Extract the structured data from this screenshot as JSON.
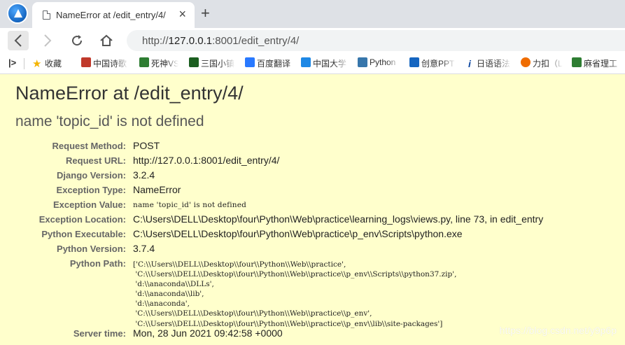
{
  "tab": {
    "title": "NameError at /edit_entry/4/",
    "close": "×",
    "new_tab": "+"
  },
  "address": {
    "scheme": "http://",
    "host": "127.0.0.1",
    "rest": ":8001/edit_entry/4/"
  },
  "bookmarks": [
    {
      "label": "收藏",
      "icon": "star-icon",
      "color": "#f4b400"
    },
    {
      "label": "中国诗歌",
      "icon": "book-icon",
      "color": "#c0392b"
    },
    {
      "label": "死神VS",
      "icon": "game-icon",
      "color": "#2e7d32"
    },
    {
      "label": "三国小镇",
      "icon": "game-icon",
      "color": "#1b5e20"
    },
    {
      "label": "百度翻译",
      "icon": "translate-icon",
      "color": "#2979ff"
    },
    {
      "label": "中国大学",
      "icon": "mooc-icon",
      "color": "#1e88e5"
    },
    {
      "label": "Python",
      "icon": "python-icon",
      "color": "#3776ab"
    },
    {
      "label": "创意PPT",
      "icon": "ppt-icon",
      "color": "#1565c0"
    },
    {
      "label": "日语语法",
      "icon": "info-icon",
      "color": "#0d47a1"
    },
    {
      "label": "力扣（L",
      "icon": "leetcode-icon",
      "color": "#ef6c00"
    },
    {
      "label": "麻省理工",
      "icon": "video-icon",
      "color": "#2e7d32"
    }
  ],
  "error": {
    "title": "NameError at /edit_entry/4/",
    "message": "name 'topic_id' is not defined"
  },
  "meta": {
    "request_method": {
      "key": "Request Method:",
      "value": "POST"
    },
    "request_url": {
      "key": "Request URL:",
      "value": "http://127.0.0.1:8001/edit_entry/4/"
    },
    "django_version": {
      "key": "Django Version:",
      "value": "3.2.4"
    },
    "exception_type": {
      "key": "Exception Type:",
      "value": "NameError"
    },
    "exception_value": {
      "key": "Exception Value:",
      "value": "name 'topic_id' is not defined"
    },
    "exception_location": {
      "key": "Exception Location:",
      "value": "C:\\Users\\DELL\\Desktop\\four\\Python\\Web\\practice\\learning_logs\\views.py, line 73, in edit_entry"
    },
    "python_executable": {
      "key": "Python Executable:",
      "value": "C:\\Users\\DELL\\Desktop\\four\\Python\\Web\\practice\\p_env\\Scripts\\python.exe"
    },
    "python_version": {
      "key": "Python Version:",
      "value": "3.7.4"
    },
    "python_path": {
      "key": "Python Path:",
      "value": "['C:\\\\Users\\\\DELL\\\\Desktop\\\\four\\\\Python\\\\Web\\\\practice',\n 'C:\\\\Users\\\\DELL\\\\Desktop\\\\four\\\\Python\\\\Web\\\\practice\\\\p_env\\\\Scripts\\\\python37.zip',\n 'd:\\\\anaconda\\\\DLLs',\n 'd:\\\\anaconda\\\\lib',\n 'd:\\\\anaconda',\n 'C:\\\\Users\\\\DELL\\\\Desktop\\\\four\\\\Python\\\\Web\\\\practice\\\\p_env',\n 'C:\\\\Users\\\\DELL\\\\Desktop\\\\four\\\\Python\\\\Web\\\\practice\\\\p_env\\\\lib\\\\site-packages']"
    },
    "server_time": {
      "key": "Server time:",
      "value": "Mon, 28 Jun 2021 09:42:58 +0000"
    }
  },
  "watermark": "https://blog.csdn.net/y9p6p"
}
